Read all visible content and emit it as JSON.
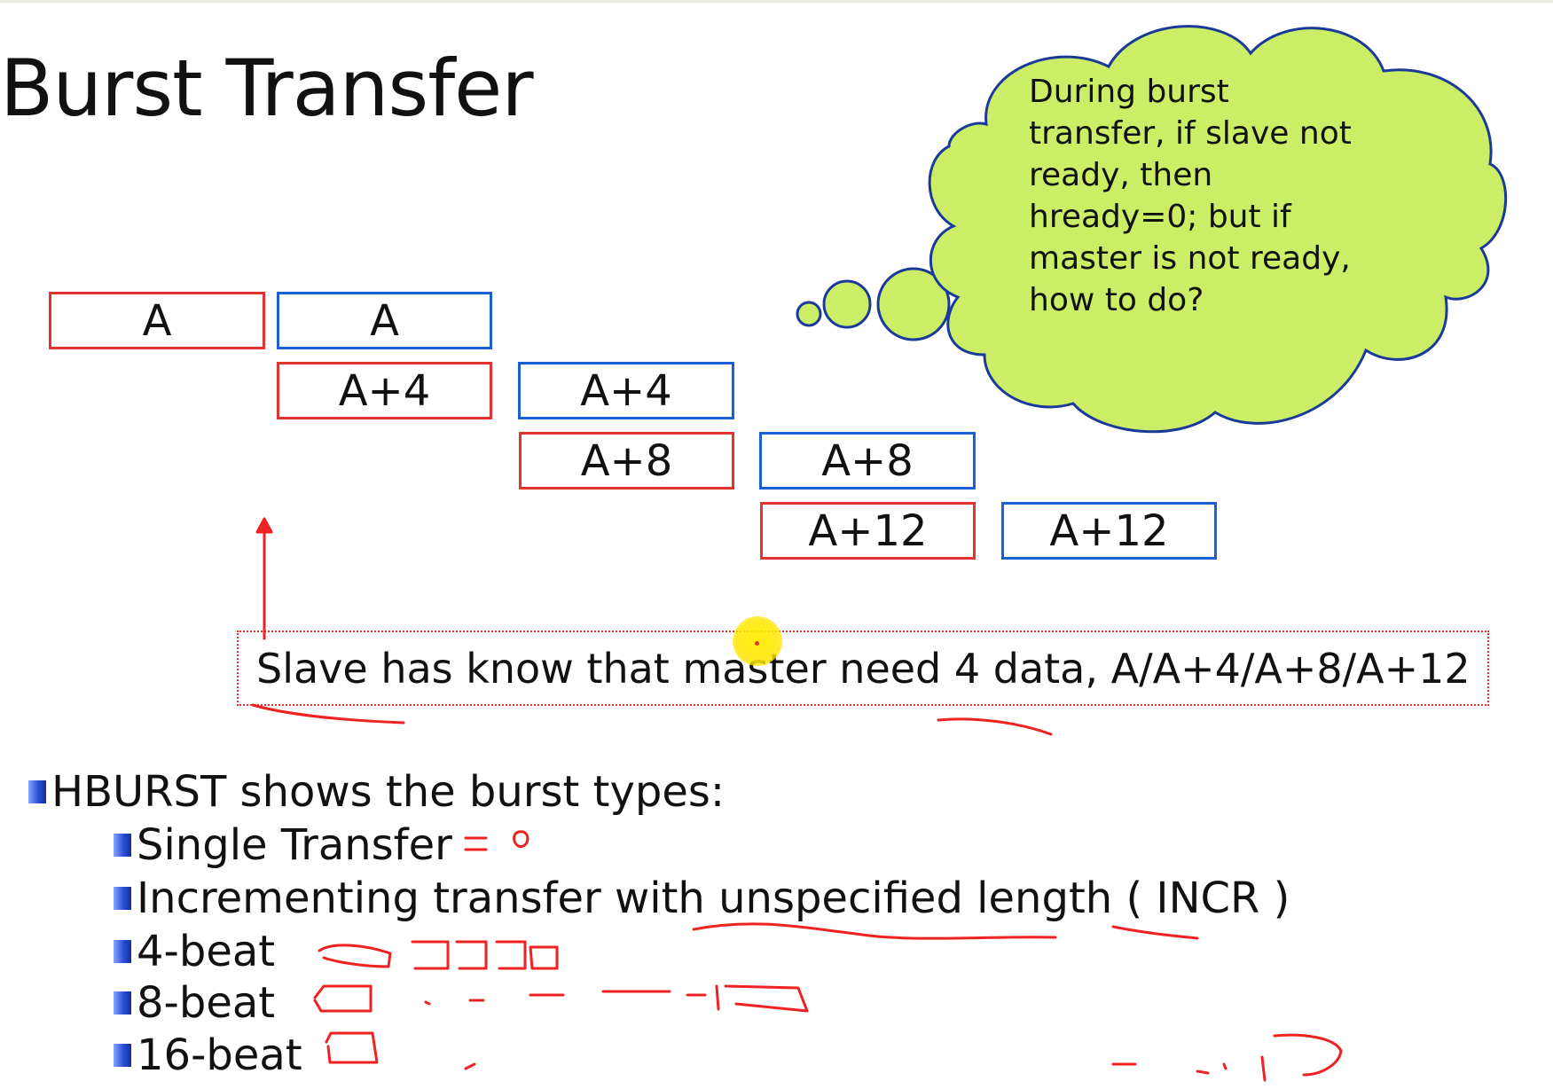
{
  "title": "Burst Transfer",
  "cloud": {
    "lines": [
      "During burst",
      "transfer, if slave not",
      "ready, then",
      "hready=0; but if",
      "master is not ready,",
      "how to do?"
    ],
    "fill": "#ccee66"
  },
  "transfer_boxes": [
    {
      "label": "A",
      "color": "red"
    },
    {
      "label": "A",
      "color": "blue"
    },
    {
      "label": "A+4",
      "color": "red"
    },
    {
      "label": "A+4",
      "color": "blue"
    },
    {
      "label": "A+8",
      "color": "red"
    },
    {
      "label": "A+8",
      "color": "blue"
    },
    {
      "label": "A+12",
      "color": "red"
    },
    {
      "label": "A+12",
      "color": "blue"
    }
  ],
  "note": "Slave has know that master need 4 data, A/A+4/A+8/A+12",
  "bullets": {
    "heading": "HBURST shows the burst types:",
    "items": [
      "Single Transfer",
      "Incrementing transfer with unspecified length ( INCR )",
      "4-beat",
      "8-beat",
      "16-beat"
    ]
  },
  "annotations": {
    "single_value": "= 0"
  },
  "colors": {
    "red": "#e3332f",
    "blue": "#1a5fd6",
    "cloud": "#ccee66",
    "ink": "#ee2222"
  }
}
